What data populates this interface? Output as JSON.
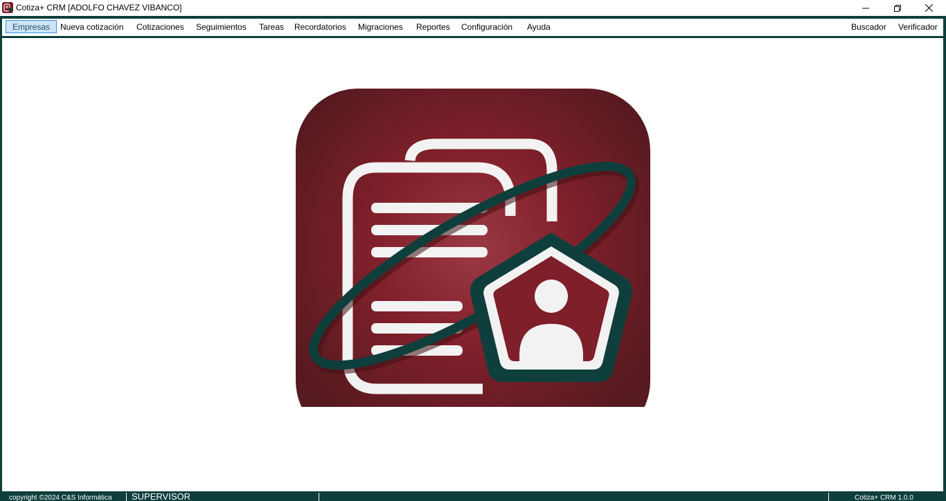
{
  "window": {
    "title": "Cotiza+ CRM [ADOLFO CHAVEZ VIBANCO]",
    "icon": "app-document-icon",
    "controls": [
      "minimize-icon",
      "restore-icon",
      "close-icon"
    ]
  },
  "menu": {
    "items": [
      {
        "label": "Empresas",
        "active": true
      },
      {
        "label": "Nueva cotización"
      },
      {
        "label": "Cotizaciones"
      },
      {
        "label": "Seguimientos"
      },
      {
        "label": "Tareas"
      },
      {
        "label": "Recordatorios"
      },
      {
        "label": "Migraciones"
      },
      {
        "label": "Reportes"
      },
      {
        "label": "Configuración"
      },
      {
        "label": "Ayuda"
      }
    ],
    "right_items": [
      {
        "label": "Buscador"
      },
      {
        "label": "Verificador"
      }
    ]
  },
  "logo": {
    "icon": "crm-documents-user-logo",
    "colors": {
      "primary": "#7a1a24",
      "accent": "#0e3f3c",
      "light": "#f2f2f2"
    }
  },
  "status": {
    "copyright": "copyright ©2024 C&S Informática",
    "role": "SUPERVISOR",
    "version": "Cotiza+ CRM 1.0.0"
  },
  "colors": {
    "frame": "#0e3f3c",
    "menu_active_bg": "#cce4f7",
    "menu_active_border": "#3d8ee0"
  }
}
